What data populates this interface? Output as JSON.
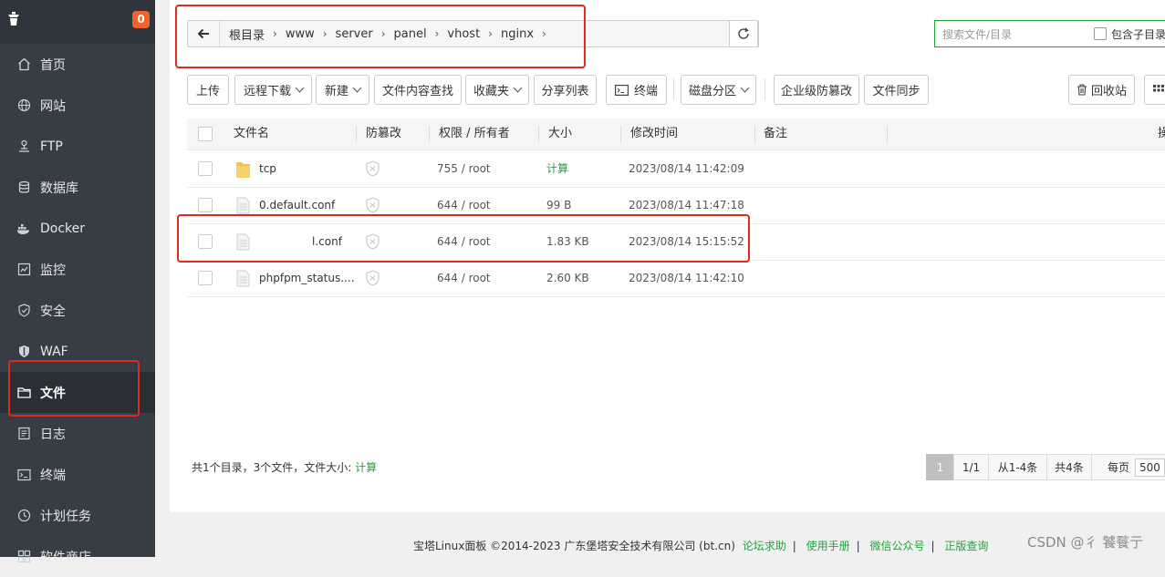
{
  "sidebar": {
    "badge": "0",
    "items": [
      {
        "label": "首页",
        "icon": "home-icon"
      },
      {
        "label": "网站",
        "icon": "globe-icon"
      },
      {
        "label": "FTP",
        "icon": "ftp-icon"
      },
      {
        "label": "数据库",
        "icon": "database-icon"
      },
      {
        "label": "Docker",
        "icon": "docker-icon"
      },
      {
        "label": "监控",
        "icon": "monitor-icon"
      },
      {
        "label": "安全",
        "icon": "shield-icon"
      },
      {
        "label": "WAF",
        "icon": "waf-icon"
      },
      {
        "label": "文件",
        "icon": "folder-icon"
      },
      {
        "label": "日志",
        "icon": "log-icon"
      },
      {
        "label": "终端",
        "icon": "terminal-icon"
      },
      {
        "label": "计划任务",
        "icon": "clock-icon"
      },
      {
        "label": "软件商店",
        "icon": "store-icon"
      }
    ],
    "active": "文件"
  },
  "path": {
    "crumbs": [
      "根目录",
      "www",
      "server",
      "panel",
      "vhost",
      "nginx"
    ]
  },
  "search": {
    "placeholder": "搜索文件/目录",
    "include_sub": "包含子目录"
  },
  "toolbar": {
    "upload": "上传",
    "remote_download": "远程下载",
    "new": "新建",
    "content_search": "文件内容查找",
    "favorites": "收藏夹",
    "share_list": "分享列表",
    "terminal": "终端",
    "disk_partition": "磁盘分区",
    "enterprise_tamper": "企业级防篡改",
    "file_sync": "文件同步",
    "recycle_bin": "回收站"
  },
  "table": {
    "headers": {
      "name": "文件名",
      "tamper": "防篡改",
      "perm": "权限 / 所有者",
      "size": "大小",
      "mtime": "修改时间",
      "note": "备注",
      "op": "操"
    },
    "rows": [
      {
        "name": "tcp",
        "type": "folder",
        "perm": "755 / root",
        "size": "计算",
        "mtime": "2023/08/14 11:42:09"
      },
      {
        "name": "0.default.conf",
        "type": "file",
        "perm": "644 / root",
        "size": "99 B",
        "mtime": "2023/08/14 11:47:18"
      },
      {
        "name": "l.conf",
        "type": "file",
        "perm": "644 / root",
        "size": "1.83 KB",
        "mtime": "2023/08/14 15:15:52"
      },
      {
        "name": "phpfpm_status....",
        "type": "file",
        "perm": "644 / root",
        "size": "2.60 KB",
        "mtime": "2023/08/14 11:42:10"
      }
    ]
  },
  "summary": {
    "text": "共1个目录，3个文件，文件大小:",
    "calc": "计算"
  },
  "pager": {
    "page": "1",
    "pages": "1/1",
    "range": "从1-4条",
    "total": "共4条",
    "per_page_label": "每页",
    "per_page": "500"
  },
  "footer": {
    "copyright": "宝塔Linux面板 ©2014-2023 广东堡塔安全技术有限公司 (bt.cn)",
    "links": [
      "论坛求助",
      "使用手册",
      "微信公众号",
      "正版查询"
    ],
    "watermark": "CSDN @彳 饕餮亍"
  },
  "colors": {
    "accent": "#20a53a",
    "sidebar_bg": "#363d45",
    "badge": "#f0642a",
    "annotation_red": "#e02a1b"
  }
}
